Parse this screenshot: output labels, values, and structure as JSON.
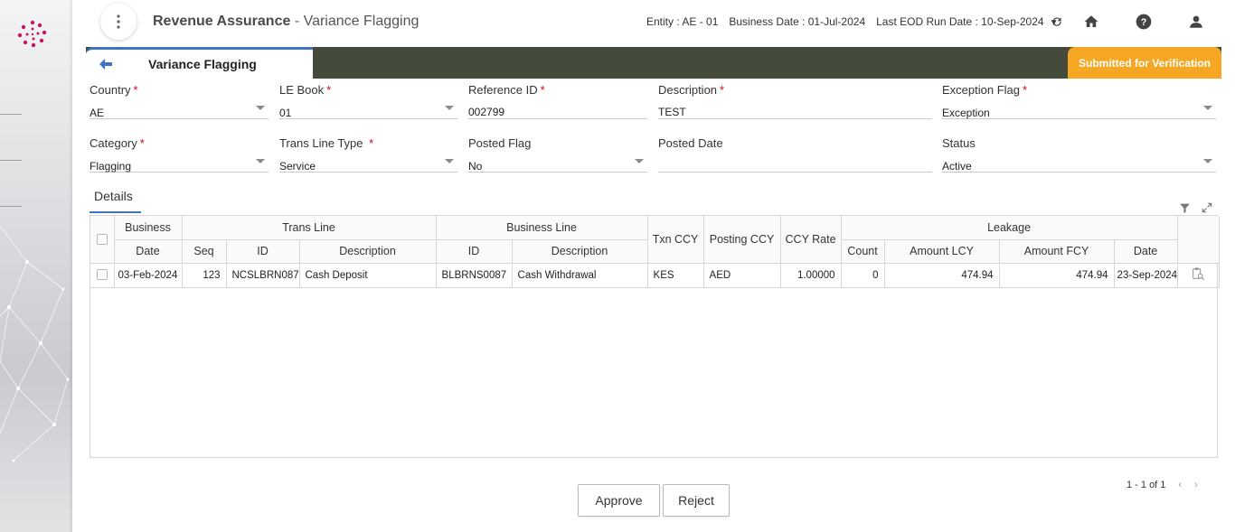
{
  "header": {
    "app_title": "Revenue Assurance",
    "separator": " - ",
    "page_title": "Variance Flagging",
    "entity": "Entity : AE - 01",
    "business_date": "Business Date : 01-Jul-2024",
    "last_eod": "Last EOD Run Date : 10-Sep-2024",
    "icons": [
      "more-vert-icon",
      "refresh-icon",
      "home-icon",
      "help-icon",
      "user-icon"
    ]
  },
  "tab": {
    "label": "Variance Flagging",
    "status": "Submitted for Verification"
  },
  "form": {
    "country": {
      "label": "Country",
      "value": "AE"
    },
    "le_book": {
      "label": "LE Book",
      "value": "01"
    },
    "reference_id": {
      "label": "Reference ID",
      "value": "002799"
    },
    "description": {
      "label": "Description",
      "value": "TEST"
    },
    "exception_flag": {
      "label": "Exception Flag",
      "value": "Exception"
    },
    "category": {
      "label": "Category",
      "value": "Flagging"
    },
    "trans_line_type": {
      "label": "Trans Line Type",
      "value": "Service"
    },
    "posted_flag": {
      "label": "Posted Flag",
      "value": "No"
    },
    "posted_date": {
      "label": "Posted Date",
      "value": ""
    },
    "status": {
      "label": "Status",
      "value": "Active"
    },
    "required_mark": "*"
  },
  "details": {
    "tab_label": "Details",
    "group_headers": {
      "business": "Business",
      "trans_line": "Trans Line",
      "business_line": "Business Line",
      "txn_ccy": "Txn CCY",
      "posting_ccy": "Posting CCY",
      "ccy_rate": "CCY Rate",
      "leakage": "Leakage"
    },
    "sub_headers": {
      "date": "Date",
      "seq": "Seq",
      "id": "ID",
      "description": "Description",
      "bl_id": "ID",
      "bl_description": "Description",
      "count": "Count",
      "amount_lcy": "Amount LCY",
      "amount_fcy": "Amount FCY",
      "leak_date": "Date"
    },
    "rows": [
      {
        "business_date": "03-Feb-2024",
        "seq": "123",
        "trans_id": "NCSLBRN087",
        "trans_desc": "Cash Deposit",
        "bl_id": "BLBRNS0087",
        "bl_desc": "Cash Withdrawal",
        "txn_ccy": "KES",
        "posting_ccy": "AED",
        "ccy_rate": "1.00000",
        "count": "0",
        "amount_lcy": "474.94",
        "amount_fcy": "474.94",
        "leak_date": "23-Sep-2024"
      }
    ]
  },
  "pagination": {
    "text": "1 - 1 of 1",
    "prev": "‹",
    "next": "›"
  },
  "actions": {
    "approve": "Approve",
    "reject": "Reject"
  }
}
